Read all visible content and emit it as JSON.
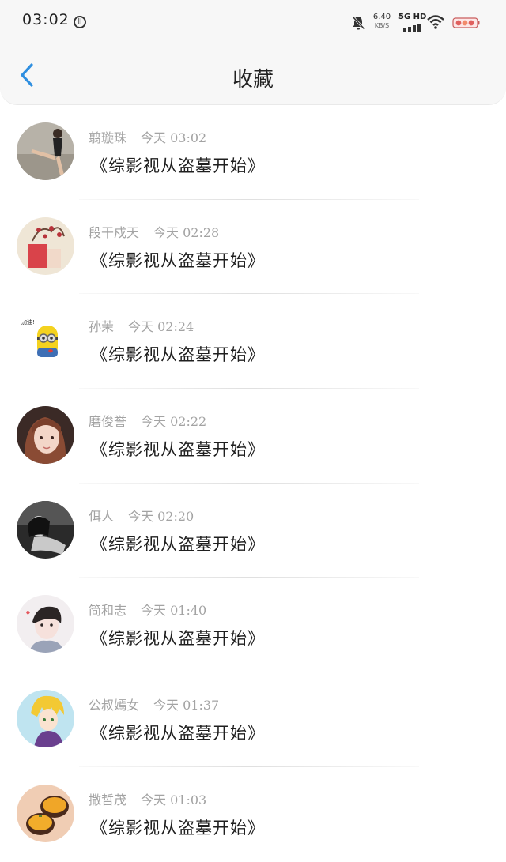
{
  "status_bar": {
    "time": "03:02",
    "time_badge": "ll",
    "speed_value": "6.40",
    "speed_unit": "KB/S",
    "network_label": "5G HD"
  },
  "header": {
    "title": "收藏"
  },
  "favorites": [
    {
      "name": "翦璇珠",
      "time": "今天 03:02",
      "title": "《综影视从盗墓开始》"
    },
    {
      "name": "段干戍天",
      "time": "今天 02:28",
      "title": "《综影视从盗墓开始》"
    },
    {
      "name": "孙茉",
      "time": "今天 02:24",
      "title": "《综影视从盗墓开始》"
    },
    {
      "name": "磨俊誉",
      "time": "今天 02:22",
      "title": "《综影视从盗墓开始》"
    },
    {
      "name": "佴人",
      "time": "今天 02:20",
      "title": "《综影视从盗墓开始》"
    },
    {
      "name": "简和志",
      "time": "今天 01:40",
      "title": "《综影视从盗墓开始》"
    },
    {
      "name": "公叔嫣女",
      "time": "今天 01:37",
      "title": "《综影视从盗墓开始》"
    },
    {
      "name": "撒哲茂",
      "time": "今天 01:03",
      "title": "《综影视从盗墓开始》"
    }
  ],
  "colors": {
    "accent": "#2f8fe0",
    "meta_text": "#a3a3a3",
    "title_text": "#1f1f1f"
  }
}
